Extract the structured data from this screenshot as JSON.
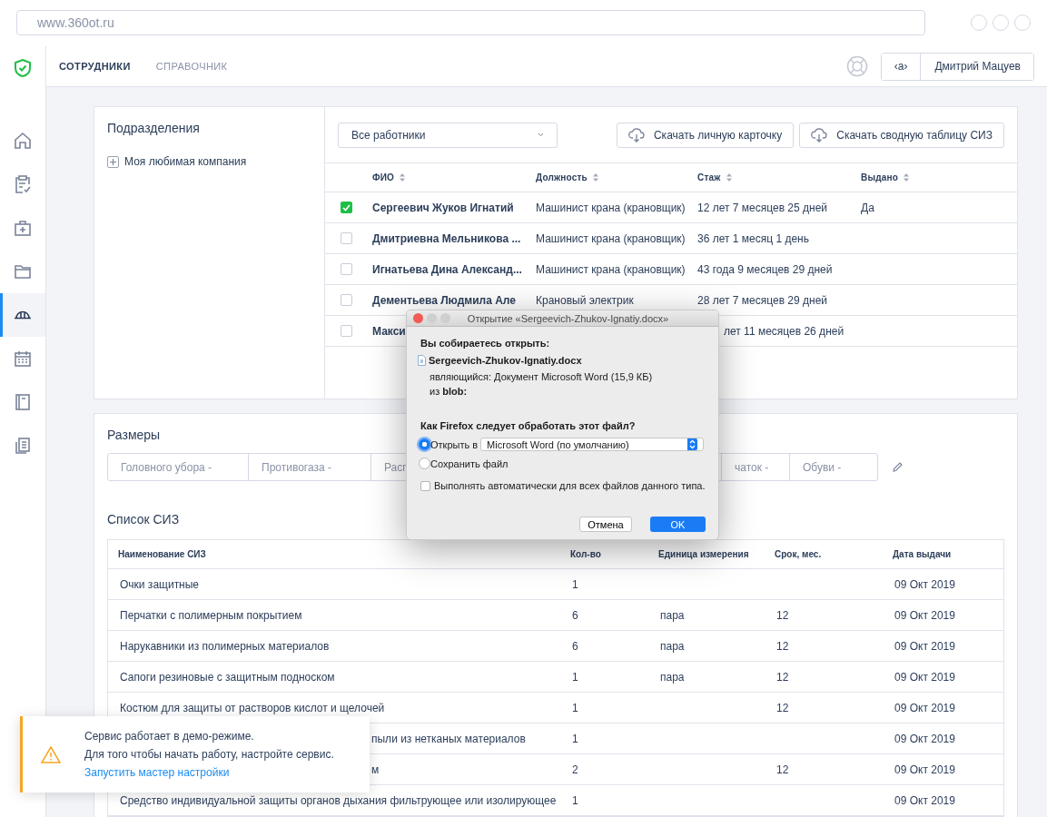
{
  "browser": {
    "url": "www.360ot.ru"
  },
  "nav": {
    "tabs": [
      {
        "label": "СОТРУДНИКИ",
        "selected": true
      },
      {
        "label": "СПРАВОЧНИК",
        "selected": false
      }
    ],
    "lang_button": "‹a›",
    "user": "Дмитрий Мацуев"
  },
  "sidebar": {
    "items": [
      {
        "kind": "home",
        "selected": false
      },
      {
        "kind": "clipboard",
        "selected": false
      },
      {
        "kind": "medkit",
        "selected": false
      },
      {
        "kind": "folder",
        "selected": false
      },
      {
        "kind": "helmet",
        "selected": true
      },
      {
        "kind": "calendar",
        "selected": false
      },
      {
        "kind": "notebook",
        "selected": false
      },
      {
        "kind": "documents",
        "selected": false
      }
    ]
  },
  "departments": {
    "title": "Подразделения",
    "tree": [
      {
        "label": "Моя любимая компания",
        "expanded": false
      }
    ]
  },
  "employees": {
    "filter": {
      "value": "Все работники"
    },
    "buttons": [
      "Скачать личную карточку",
      "Скачать сводную таблицу СИЗ"
    ],
    "columns": [
      "ФИО",
      "Должность",
      "Стаж",
      "Выдано"
    ],
    "rows": [
      {
        "checked": true,
        "covered": false,
        "name": "Сергеевич Жуков Игнатий",
        "position": "Машинист крана (крановщик)",
        "experience": "12 лет 7 месяцев 25 дней",
        "issued": "Да"
      },
      {
        "checked": false,
        "covered": false,
        "name": "Дмитриевна Мельникова ...",
        "position": "Машинист крана (крановщик)",
        "experience": "36 лет 1 месяц 1 день"
      },
      {
        "checked": false,
        "covered": false,
        "name": "Игнатьева Дина Александ...",
        "position": "Машинист крана (крановщик)",
        "experience": "43 года 9 месяцев 29 дней"
      },
      {
        "checked": false,
        "covered": false,
        "name": "Дементьева Людмила Але",
        "position": "Крановый электрик",
        "experience": "28 лет 7 месяцев 29 дней"
      },
      {
        "checked": false,
        "covered": true,
        "name": "Макси",
        "experience": "лет 11 месяцев 26 дней"
      }
    ]
  },
  "sizes": {
    "title": "Размеры",
    "fields": [
      {
        "label": "Головного убора",
        "value": "-"
      },
      {
        "label": "Противогаза",
        "value": "-"
      },
      {
        "label": "Расп"
      },
      {
        "label": "чаток",
        "value": "-"
      },
      {
        "label": "Обуви",
        "value": "-"
      }
    ]
  },
  "siz": {
    "title": "Список СИЗ",
    "columns": [
      "Наименование СИЗ",
      "Кол-во",
      "Единица измерения",
      "Срок, мес.",
      "Дата выдачи"
    ],
    "rows": [
      {
        "covered": false,
        "name": "Очки защитные",
        "qty": "1",
        "date": "09 Окт 2019"
      },
      {
        "covered": false,
        "name": "Перчатки с полимерным покрытием",
        "qty": "6",
        "unit": "пара",
        "term": "12",
        "date": "09 Окт 2019"
      },
      {
        "covered": false,
        "name": "Нарукавники из полимерных материалов",
        "qty": "6",
        "unit": "пара",
        "term": "12",
        "date": "09 Окт 2019"
      },
      {
        "covered": false,
        "name": "Сапоги резиновые с защитным подноском",
        "qty": "1",
        "unit": "пара",
        "term": "12",
        "date": "09 Окт 2019"
      },
      {
        "covered": false,
        "name": "Костюм для защиты от растворов кислот и щелочей",
        "qty": "1",
        "term": "12",
        "date": "09 Окт 2019"
      },
      {
        "covered": true,
        "name": "пыли из нетканых материалов",
        "qty": "1",
        "date": "09 Окт 2019"
      },
      {
        "covered": true,
        "name": "м",
        "qty": "2",
        "term": "12",
        "date": "09 Окт 2019"
      },
      {
        "covered": false,
        "name": "Средство индивидуальной защиты органов дыхания фильтрующее или изолирующее",
        "qty": "1",
        "date": "09 Окт 2019"
      }
    ]
  },
  "dialog": {
    "title": "Открытие «Sergeevich-Zhukov-Ignatiy.docx»",
    "heading": "Вы собираетесь открыть:",
    "file": "Sergeevich-Zhukov-Ignatiy.docx",
    "type_line": "являющийся: Документ Microsoft Word (15,9 КБ)",
    "source": "из **blob:**",
    "question": "Как Firefox следует обработать этот файл?",
    "options": [
      {
        "label": "Открыть в",
        "selected": true,
        "app": "Microsoft Word (по умолчанию)"
      },
      {
        "label": "Сохранить файл",
        "selected": false
      }
    ],
    "auto": {
      "label": "Выполнять автоматически для всех файлов данного типа.",
      "checked": false
    },
    "cancel": "Отмена",
    "ok": "OK"
  },
  "toast": {
    "lines": [
      "Сервис работает в демо-режиме.",
      "Для того чтобы начать работу, настройте сервис."
    ],
    "link": "Запустить мастер настройки"
  }
}
